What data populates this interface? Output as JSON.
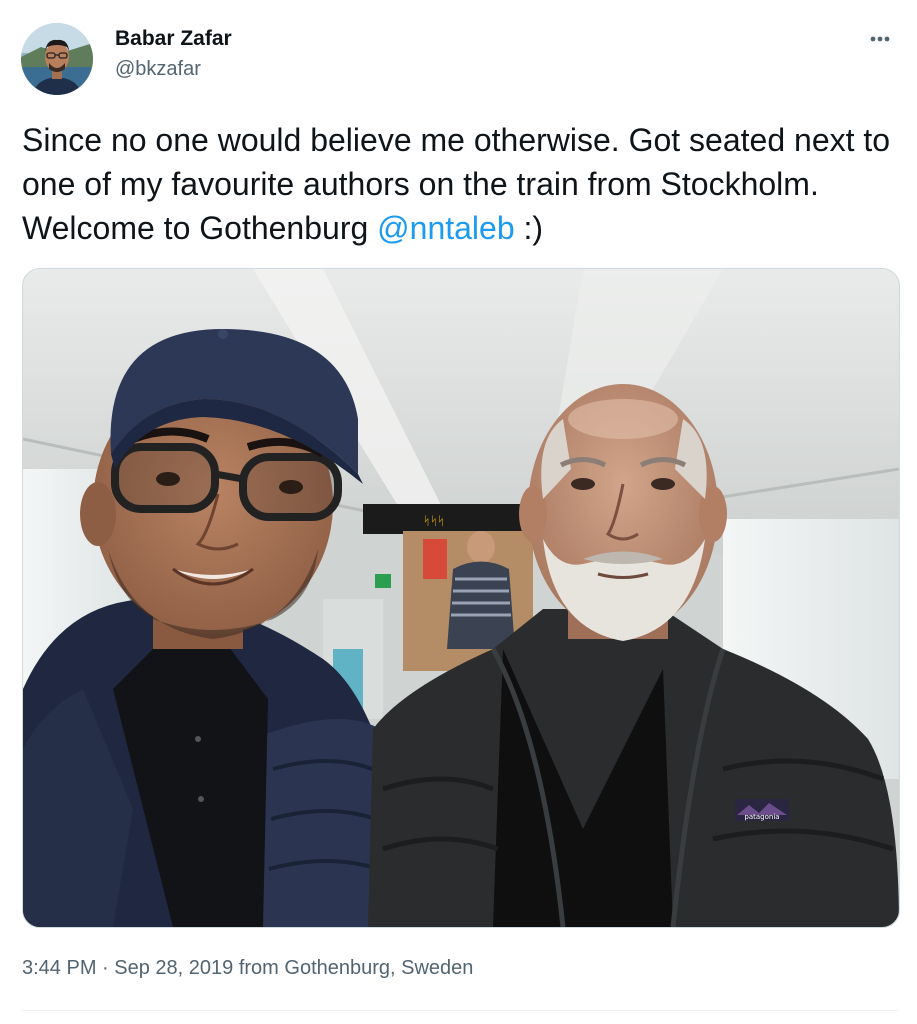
{
  "user": {
    "name": "Babar Zafar",
    "handle": "@bkzafar"
  },
  "tweet": {
    "text_part1": "Since no one would believe me otherwise. Got seated next to one of my favourite authors on the train from Stockholm. Welcome to Gothenburg ",
    "mention": "@nntaleb",
    "text_part2": " :)"
  },
  "photo": {
    "train_sign": "ᛋᛋᛋ",
    "jacket_logo": "patagonia"
  },
  "meta": {
    "time": "3:44 PM",
    "separator": " · ",
    "date": "Sep 28, 2019",
    "from_text": " from ",
    "location": "Gothenburg, Sweden"
  },
  "colors": {
    "link": "#1d9bf0",
    "secondary_text": "#536471",
    "primary_text": "#0f1419"
  },
  "icons": {
    "more": "more-dots-icon"
  }
}
